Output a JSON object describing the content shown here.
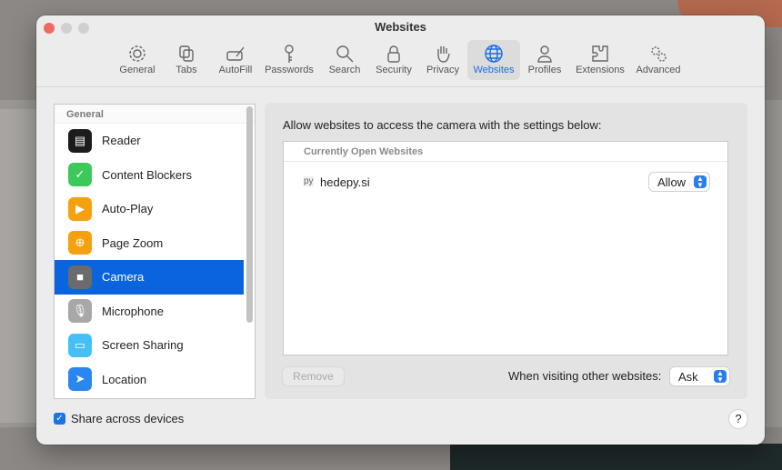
{
  "window": {
    "title": "Websites"
  },
  "toolbar": [
    {
      "label": "General",
      "icon": "gear-icon"
    },
    {
      "label": "Tabs",
      "icon": "tabs-icon"
    },
    {
      "label": "AutoFill",
      "icon": "autofill-icon"
    },
    {
      "label": "Passwords",
      "icon": "key-icon"
    },
    {
      "label": "Search",
      "icon": "search-icon"
    },
    {
      "label": "Security",
      "icon": "lock-icon"
    },
    {
      "label": "Privacy",
      "icon": "hand-icon"
    },
    {
      "label": "Websites",
      "icon": "globe-icon",
      "selected": true
    },
    {
      "label": "Profiles",
      "icon": "person-icon"
    },
    {
      "label": "Extensions",
      "icon": "puzzle-icon"
    },
    {
      "label": "Advanced",
      "icon": "gears-icon"
    }
  ],
  "sidebar": {
    "header": "General",
    "items": [
      {
        "label": "Reader",
        "color": "#1c1c1c"
      },
      {
        "label": "Content Blockers",
        "color": "#3cc85a"
      },
      {
        "label": "Auto-Play",
        "color": "#f5a00f"
      },
      {
        "label": "Page Zoom",
        "color": "#f5a00f"
      },
      {
        "label": "Camera",
        "color": "#6b6b6b",
        "selected": true
      },
      {
        "label": "Microphone",
        "color": "#a8a8a8"
      },
      {
        "label": "Screen Sharing",
        "color": "#45bff5"
      },
      {
        "label": "Location",
        "color": "#2a86f0"
      }
    ]
  },
  "main": {
    "description": "Allow websites to access the camera with the settings below:",
    "table_header": "Currently Open Websites",
    "sites": [
      {
        "name": "hedepy.si",
        "favicon": "py",
        "value": "Allow"
      }
    ],
    "remove_label": "Remove",
    "other_label": "When visiting other websites:",
    "other_value": "Ask"
  },
  "footer": {
    "share_label": "Share across devices",
    "share_checked": true,
    "help": "?"
  },
  "colors": {
    "accent": "#0a64dd"
  }
}
